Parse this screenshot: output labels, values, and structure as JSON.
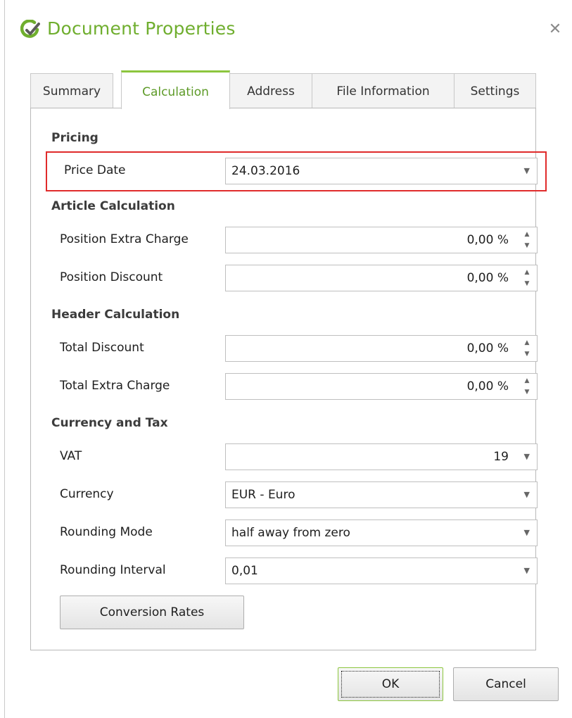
{
  "window": {
    "title": "Document Properties",
    "close_glyph": "✕",
    "icon": "logo-check-icon",
    "accent_color": "#6fae2e"
  },
  "tabs": [
    {
      "label": "Summary",
      "active": false
    },
    {
      "label": "Calculation",
      "active": true
    },
    {
      "label": "Address",
      "active": false
    },
    {
      "label": "File Information",
      "active": false
    },
    {
      "label": "Settings",
      "active": false
    }
  ],
  "pricing": {
    "heading": "Pricing",
    "price_date_label": "Price Date",
    "price_date_value": "24.03.2016"
  },
  "article_calc": {
    "heading": "Article Calculation",
    "position_extra_charge_label": "Position Extra Charge",
    "position_extra_charge_value": "0,00 %",
    "position_discount_label": "Position Discount",
    "position_discount_value": "0,00 %"
  },
  "header_calc": {
    "heading": "Header Calculation",
    "total_discount_label": "Total Discount",
    "total_discount_value": "0,00 %",
    "total_extra_charge_label": "Total Extra Charge",
    "total_extra_charge_value": "0,00 %"
  },
  "currency_tax": {
    "heading": "Currency and Tax",
    "vat_label": "VAT",
    "vat_value": "19",
    "currency_label": "Currency",
    "currency_value": "EUR - Euro",
    "rounding_mode_label": "Rounding Mode",
    "rounding_mode_value": "half away from zero",
    "rounding_interval_label": "Rounding Interval",
    "rounding_interval_value": "0,01"
  },
  "buttons": {
    "conversion_rates": "Conversion Rates",
    "ok": "OK",
    "cancel": "Cancel"
  },
  "glyphs": {
    "spin_up": "▲",
    "spin_down": "▼",
    "dropdown": "▼"
  },
  "highlight_color": "#e02b2b"
}
